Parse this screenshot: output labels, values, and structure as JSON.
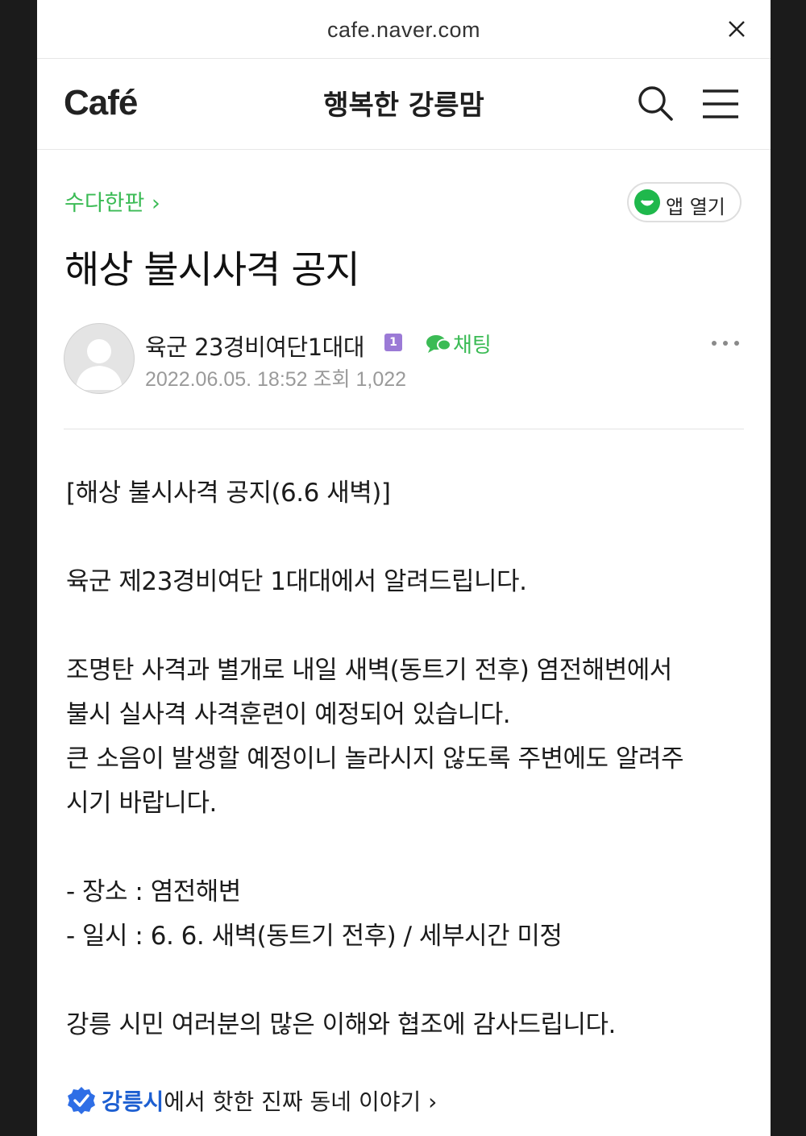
{
  "browser": {
    "url": "cafe.naver.com"
  },
  "header": {
    "logo": "Café",
    "cafe_name": "행복한 강릉맘"
  },
  "article": {
    "board": "수다한판 ›",
    "app_open_label": "앱 열기",
    "title": "해상 불시사격 공지",
    "author": "육군 23경비여단1대대",
    "level_badge": "1",
    "chat_label": "채팅",
    "date": "2022.06.05. 18:52",
    "views_label": "조회",
    "views": "1,022",
    "body": [
      "[해상 불시사격 공지(6.6 새벽)]",
      "육군 제23경비여단 1대대에서 알려드립니다.",
      "조명탄 사격과 별개로 내일 새벽(동트기 전후) 염전해변에서",
      "불시 실사격 사격훈련이 예정되어 있습니다.",
      "큰 소음이 발생할 예정이니 놀라시지 않도록 주변에도 알려주",
      "시기 바랍니다.",
      "- 장소 : 염전해변",
      "- 일시 : 6. 6. 새벽(동트기 전후) / 세부시간 미정",
      "강릉 시민 여러분의 많은 이해와 협조에 감사드립니다."
    ]
  },
  "local_banner": {
    "highlight": "강릉시",
    "rest": "에서 핫한 진짜 동네 이야기 ›"
  }
}
